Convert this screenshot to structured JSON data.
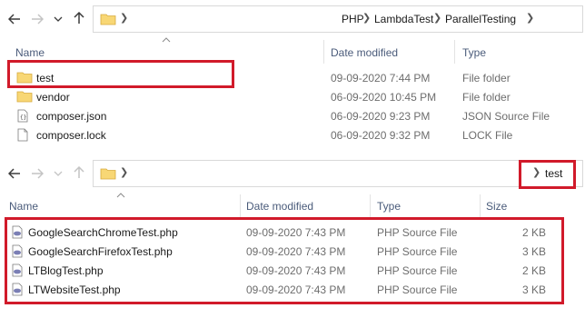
{
  "top": {
    "breadcrumb": [
      "PHP",
      "LambdaTest",
      "ParallelTesting"
    ],
    "columns": {
      "name": "Name",
      "date": "Date modified",
      "type": "Type"
    },
    "files": [
      {
        "name": "test",
        "date": "09-09-2020 7:44 PM",
        "type": "File folder",
        "icon": "folder-icon"
      },
      {
        "name": "vendor",
        "date": "06-09-2020 10:45 PM",
        "type": "File folder",
        "icon": "folder-icon"
      },
      {
        "name": "composer.json",
        "date": "06-09-2020 9:23 PM",
        "type": "JSON Source File",
        "icon": "json-file-icon"
      },
      {
        "name": "composer.lock",
        "date": "06-09-2020 9:32 PM",
        "type": "LOCK File",
        "icon": "document-icon"
      }
    ]
  },
  "bottom": {
    "breadcrumb": [
      "test"
    ],
    "columns": {
      "name": "Name",
      "date": "Date modified",
      "type": "Type",
      "size": "Size"
    },
    "files": [
      {
        "name": "GoogleSearchChromeTest.php",
        "date": "09-09-2020 7:43 PM",
        "type": "PHP Source File",
        "size": "2 KB",
        "icon": "php-file-icon"
      },
      {
        "name": "GoogleSearchFirefoxTest.php",
        "date": "09-09-2020 7:43 PM",
        "type": "PHP Source File",
        "size": "3 KB",
        "icon": "php-file-icon"
      },
      {
        "name": "LTBlogTest.php",
        "date": "09-09-2020 7:43 PM",
        "type": "PHP Source File",
        "size": "2 KB",
        "icon": "php-file-icon"
      },
      {
        "name": "LTWebsiteTest.php",
        "date": "09-09-2020 7:43 PM",
        "type": "PHP Source File",
        "size": "3 KB",
        "icon": "php-file-icon"
      }
    ]
  },
  "colors": {
    "highlight": "#d11a2a",
    "folder": "#f8d775",
    "header_text": "#4a5b7a"
  }
}
